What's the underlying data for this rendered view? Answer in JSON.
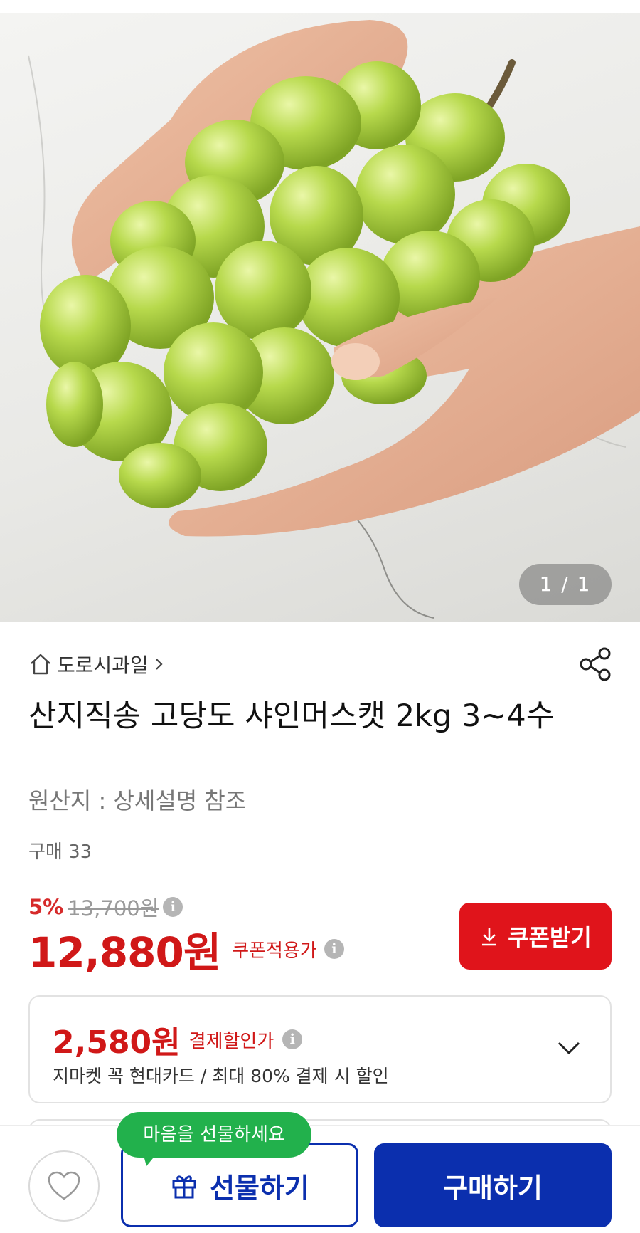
{
  "image": {
    "counter": "1 / 1",
    "alt": "shine-muscat-grapes-photo"
  },
  "store": {
    "name": "도로시과일"
  },
  "product": {
    "title": "산지직송 고당도 샤인머스캣 2kg 3~4수",
    "origin": "원산지 : 상세설명 참조",
    "purchases": "구매 33"
  },
  "price": {
    "discount_rate": "5%",
    "original": "13,700원",
    "sale": "12,880원",
    "sale_label": "쿠폰적용가",
    "coupon_button": "쿠폰받기"
  },
  "card_offer": {
    "price": "2,580원",
    "label": "결제할인가",
    "description": "지마켓 꼭 현대카드 / 최대 80% 결제 시 할인"
  },
  "bottom_bar": {
    "gift_tooltip": "마음을 선물하세요",
    "gift_button": "선물하기",
    "buy_button": "구매하기"
  },
  "colors": {
    "sale_red": "#d01818",
    "coupon_red": "#e0141b",
    "brand_blue": "#0b2fae",
    "tooltip_green": "#22b14c"
  }
}
